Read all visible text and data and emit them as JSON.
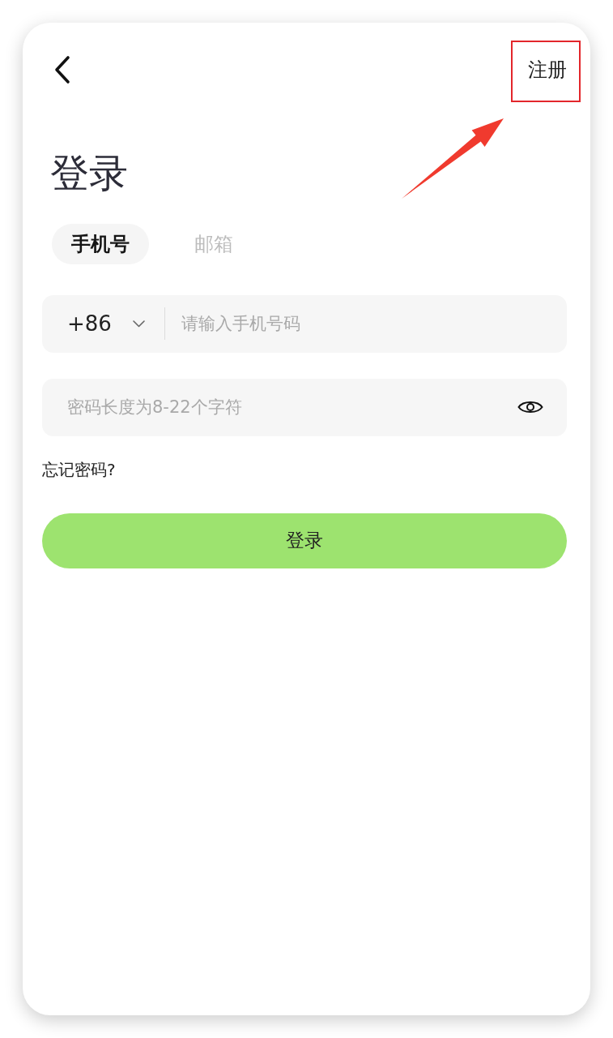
{
  "register_link": {
    "label": "注册",
    "highlighted": true
  },
  "title": "登录",
  "tabs": [
    {
      "label": "手机号",
      "selected": true
    },
    {
      "label": "邮箱",
      "selected": false
    }
  ],
  "phone_field": {
    "country_code": "+86",
    "placeholder": "请输入手机号码"
  },
  "password_field": {
    "placeholder": "密码长度为8-22个字符"
  },
  "forgot_password": "忘记密码?",
  "login_button": {
    "label": "登录"
  }
}
